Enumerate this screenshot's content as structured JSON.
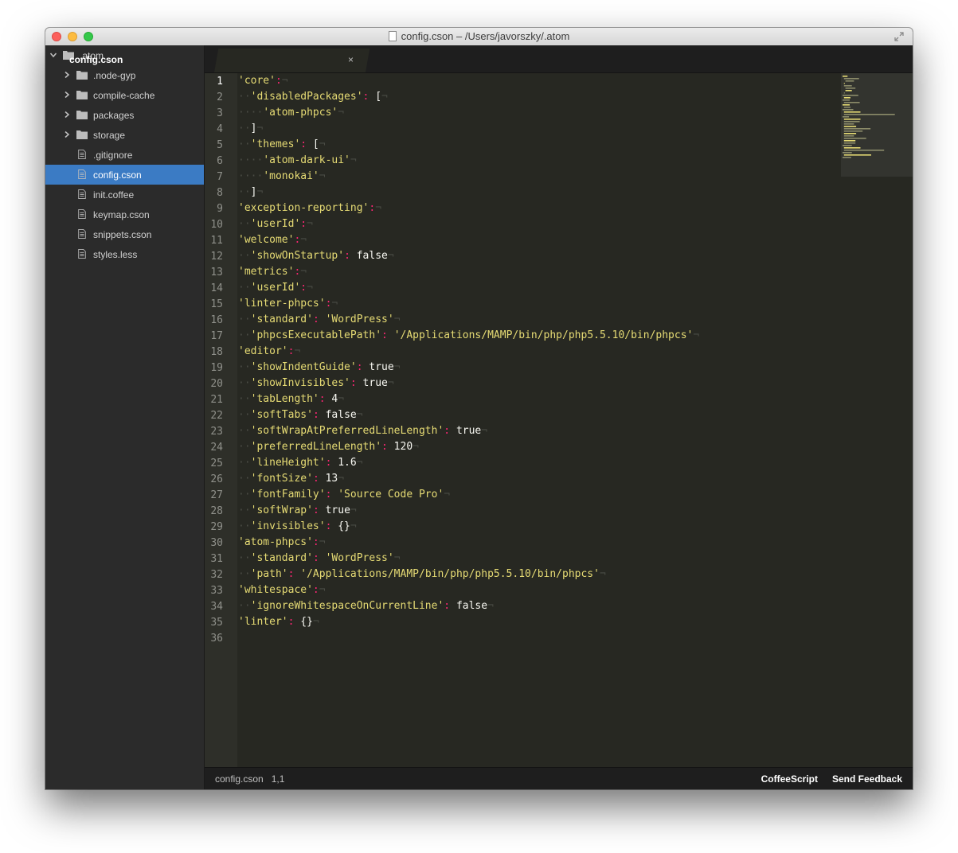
{
  "window": {
    "title": "config.cson – /Users/javorszky/.atom"
  },
  "tree": {
    "root": ".atom",
    "folders": [
      ".node-gyp",
      "compile-cache",
      "packages",
      "storage"
    ],
    "files": [
      ".gitignore",
      "config.cson",
      "init.coffee",
      "keymap.cson",
      "snippets.cson",
      "styles.less"
    ],
    "selected": "config.cson"
  },
  "tab": {
    "label": "config.cson",
    "close": "×"
  },
  "editor": {
    "active_line": 1,
    "line_count": 36,
    "lines": [
      "'core':",
      "  'disabledPackages': [",
      "    'atom-phpcs'",
      "  ]",
      "  'themes': [",
      "    'atom-dark-ui'",
      "    'monokai'",
      "  ]",
      "'exception-reporting':",
      "  'userId':",
      "'welcome':",
      "  'showOnStartup': false",
      "'metrics':",
      "  'userId':",
      "'linter-phpcs':",
      "  'standard': 'WordPress'",
      "  'phpcsExecutablePath': '/Applications/MAMP/bin/php/php5.5.10/bin/phpcs'",
      "'editor':",
      "  'showIndentGuide': true",
      "  'showInvisibles': true",
      "  'tabLength': 4",
      "  'softTabs': false",
      "  'softWrapAtPreferredLineLength': true",
      "  'preferredLineLength': 120",
      "  'lineHeight': 1.6",
      "  'fontSize': 13",
      "  'fontFamily': 'Source Code Pro'",
      "  'softWrap': true",
      "  'invisibles': {}",
      "'atom-phpcs':",
      "  'standard': 'WordPress'",
      "  'path': '/Applications/MAMP/bin/php/php5.5.10/bin/phpcs'",
      "'whitespace':",
      "  'ignoreWhitespaceOnCurrentLine': false",
      "'linter': {}",
      ""
    ]
  },
  "status": {
    "file": "config.cson",
    "position": "1,1",
    "grammar": "CoffeeScript",
    "feedback": "Send Feedback"
  },
  "colors": {
    "string": "#e6db74",
    "keyword": "#ae81ff",
    "punctuation": "#f92672",
    "selection": "#3b7bc4",
    "invisible": "#4a4b44"
  }
}
